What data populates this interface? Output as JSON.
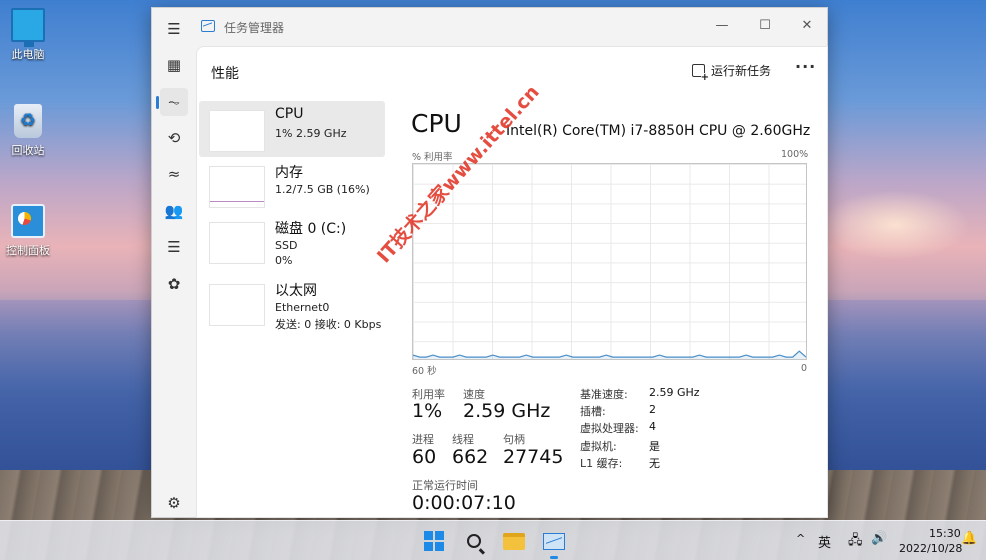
{
  "desktop": {
    "icons": [
      {
        "label": "此电脑",
        "icon": "computer-icon"
      },
      {
        "label": "回收站",
        "icon": "recycle-bin-icon"
      },
      {
        "label": "控制面板",
        "icon": "control-panel-icon"
      }
    ]
  },
  "window": {
    "title": "任务管理器",
    "controls": {
      "minimize": "—",
      "maximize": "☐",
      "close": "✕"
    }
  },
  "nav": {
    "items": [
      {
        "name": "hamburger-menu-icon",
        "glyph": "☰"
      },
      {
        "name": "processes-icon",
        "glyph": "▦"
      },
      {
        "name": "performance-icon",
        "glyph": "⏦"
      },
      {
        "name": "app-history-icon",
        "glyph": "⟲"
      },
      {
        "name": "startup-apps-icon",
        "glyph": "≈"
      },
      {
        "name": "users-icon",
        "glyph": "👥"
      },
      {
        "name": "details-icon",
        "glyph": "☰"
      },
      {
        "name": "services-icon",
        "glyph": "✿"
      },
      {
        "name": "settings-icon",
        "glyph": "⚙"
      }
    ]
  },
  "header": {
    "title": "性能",
    "run_task": "运行新任务",
    "more": "···"
  },
  "resources": [
    {
      "name": "CPU",
      "sub1": "1%  2.59 GHz",
      "sub2": "",
      "sub3": ""
    },
    {
      "name": "内存",
      "sub1": "1.2/7.5 GB (16%)",
      "sub2": "",
      "sub3": ""
    },
    {
      "name": "磁盘 0 (C:)",
      "sub1": "SSD",
      "sub2": "0%",
      "sub3": ""
    },
    {
      "name": "以太网",
      "sub1": "Ethernet0",
      "sub2": "发送: 0 接收: 0 Kbps",
      "sub3": ""
    }
  ],
  "detail": {
    "title": "CPU",
    "model": "Intel(R) Core(TM) i7-8850H CPU @ 2.60GHz",
    "y_label": "% 利用率",
    "y_max": "100%",
    "x_left": "60 秒",
    "x_right": "0",
    "stats": {
      "util_label": "利用率",
      "util_value": "1%",
      "speed_label": "速度",
      "speed_value": "2.59 GHz",
      "proc_label": "进程",
      "proc_value": "60",
      "thread_label": "线程",
      "thread_value": "662",
      "handle_label": "句柄",
      "handle_value": "27745",
      "uptime_label": "正常运行时间",
      "uptime_value": "0:00:07:10"
    },
    "specs": [
      {
        "k": "基准速度:",
        "v": "2.59 GHz"
      },
      {
        "k": "插槽:",
        "v": "2"
      },
      {
        "k": "虚拟处理器:",
        "v": "4"
      },
      {
        "k": "虚拟机:",
        "v": "是"
      },
      {
        "k": "L1 缓存:",
        "v": "无"
      }
    ]
  },
  "chart_data": {
    "type": "line",
    "xlabel": "",
    "ylabel": "% 利用率",
    "ylim": [
      0,
      100
    ],
    "x_range_seconds": [
      60,
      0
    ],
    "series": [
      {
        "values": [
          2,
          1,
          1,
          2,
          1,
          1,
          1,
          2,
          1,
          1,
          1,
          1,
          2,
          1,
          1,
          1,
          1,
          2,
          1,
          1,
          1,
          1,
          1,
          2,
          1,
          1,
          1,
          1,
          1,
          2,
          1,
          1,
          1,
          1,
          1,
          1,
          1,
          2,
          1,
          1,
          1,
          1,
          1,
          2,
          1,
          1,
          1,
          1,
          1,
          1,
          2,
          1,
          1,
          1,
          1,
          2,
          1,
          1,
          4,
          1
        ]
      }
    ],
    "line_color": "#4a8ec8"
  },
  "watermark": "IT技术之家www.ittel.cn",
  "taskbar": {
    "lang": "英",
    "time": "15:30",
    "date": "2022/10/28",
    "tray_up": "^"
  }
}
